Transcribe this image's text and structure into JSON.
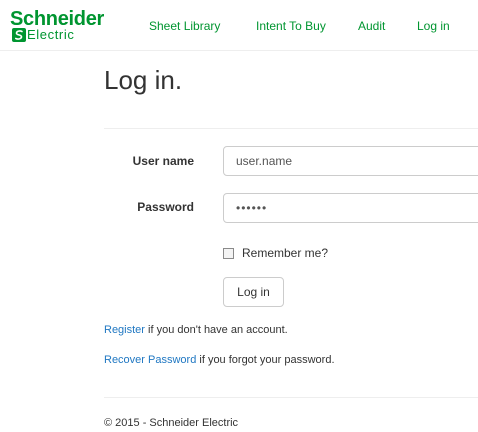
{
  "colors": {
    "brand_green": "#009530",
    "link_blue": "#1f77c2",
    "text": "#333333",
    "border": "#cccccc",
    "divider": "#eeeeee"
  },
  "logo": {
    "name": "Schneider",
    "sub": "Electric",
    "mark_icon": "schneider-s-mark-icon"
  },
  "nav": {
    "items": [
      {
        "label": "Sheet Library"
      },
      {
        "label": "Intent To Buy"
      },
      {
        "label": "Audit"
      },
      {
        "label": "Log in"
      }
    ]
  },
  "page": {
    "title": "Log in."
  },
  "form": {
    "username_label": "User name",
    "username_value": "user.name",
    "password_label": "Password",
    "password_value": "••••••",
    "remember_label": "Remember me?",
    "remember_checked": false,
    "submit_label": "Log in"
  },
  "links": {
    "register_link": "Register",
    "register_rest": " if you don't have an account.",
    "recover_link": "Recover Password",
    "recover_rest": " if you forgot your password."
  },
  "footer": {
    "text": "© 2015 - Schneider Electric"
  }
}
